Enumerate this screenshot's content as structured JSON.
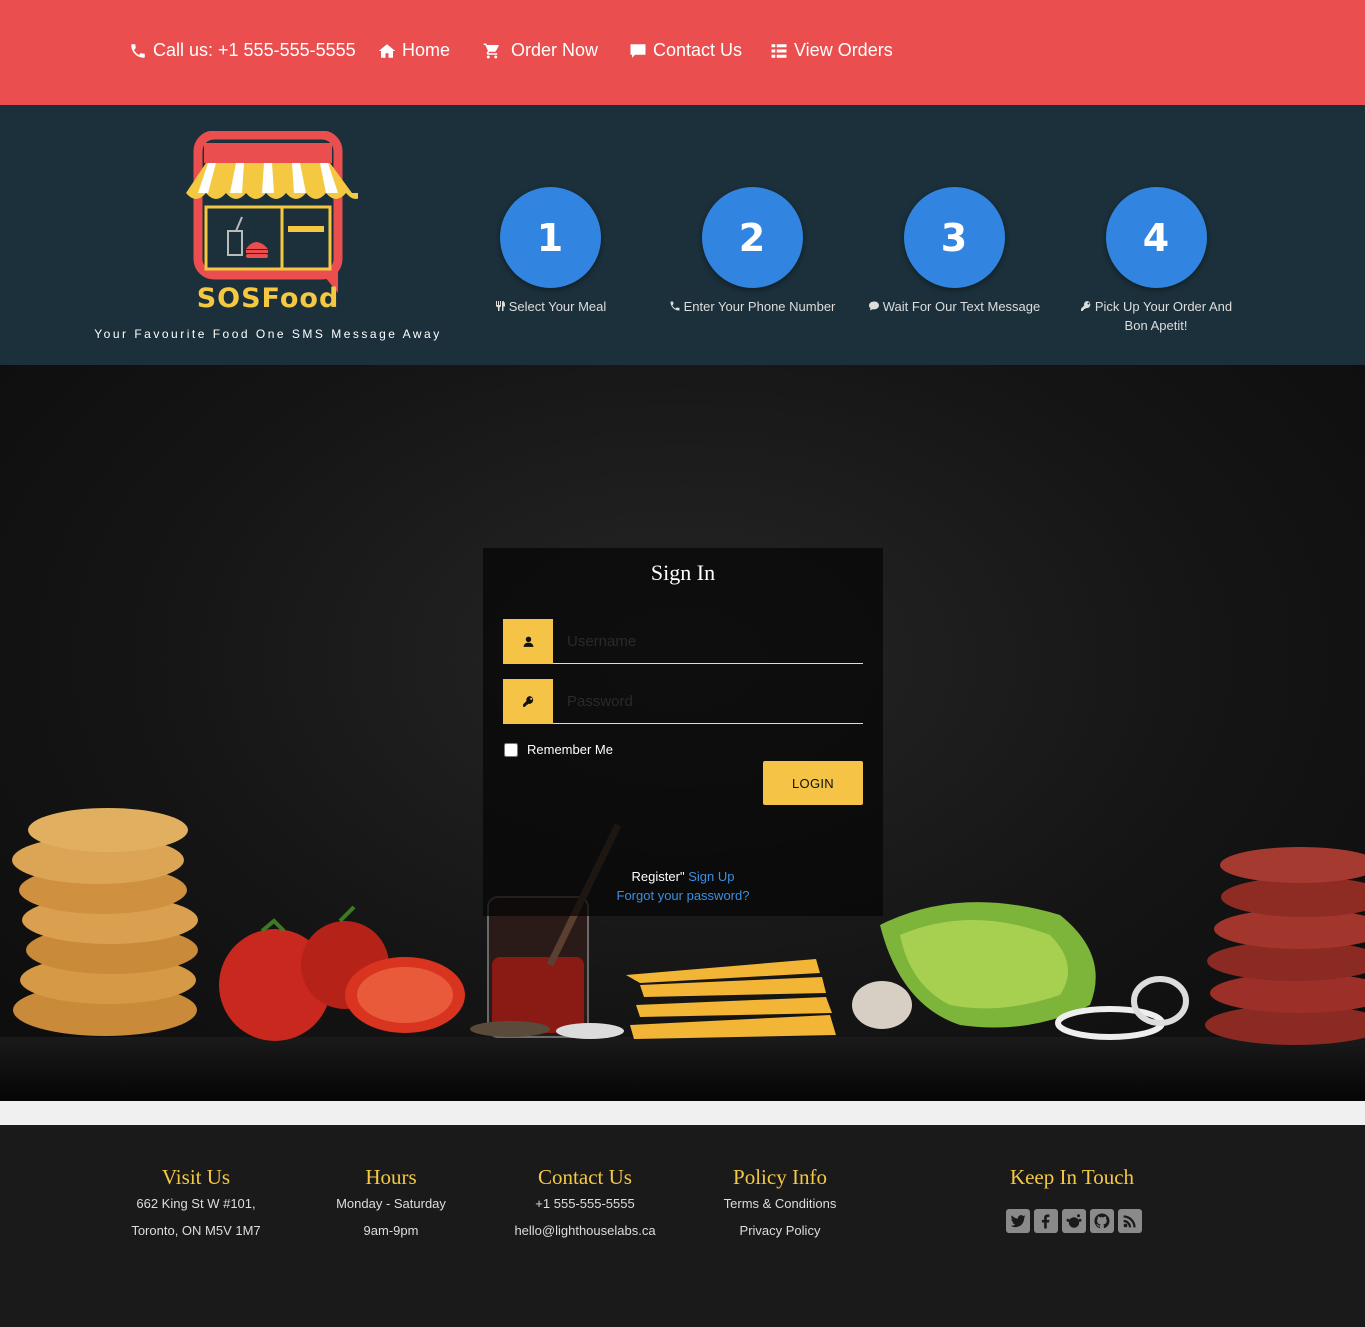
{
  "nav": {
    "call": "Call us: +1 555-555-5555",
    "home": "Home",
    "order": "Order Now",
    "contact": "Contact Us",
    "view_orders": "View Orders"
  },
  "brand": {
    "name": "SOSFood",
    "tagline": "Your Favourite Food One SMS Message Away"
  },
  "steps": [
    {
      "number": "1",
      "label": "Select Your Meal",
      "icon": "cutlery-icon"
    },
    {
      "number": "2",
      "label": "Enter Your Phone Number",
      "icon": "phone-icon"
    },
    {
      "number": "3",
      "label": "Wait For Our Text Message",
      "icon": "comment-icon"
    },
    {
      "number": "4",
      "label": "Pick Up Your Order And Bon Apetit!",
      "icon": "key-icon"
    }
  ],
  "signin": {
    "title": "Sign In",
    "username_placeholder": "Username",
    "password_placeholder": "Password",
    "remember": "Remember Me",
    "login": "LOGIN",
    "register_text": "Register\"",
    "signup_link": "Sign Up",
    "forgot": "Forgot your password?"
  },
  "footer": {
    "visit": {
      "title": "Visit Us",
      "line1": "662 King St W #101,",
      "line2": "Toronto, ON M5V 1M7"
    },
    "hours": {
      "title": "Hours",
      "line1": "Monday - Saturday",
      "line2": "9am-9pm"
    },
    "contact": {
      "title": "Contact Us",
      "line1": "+1 555-555-5555",
      "line2": "hello@lighthouselabs.ca"
    },
    "policy": {
      "title": "Policy Info",
      "line1": "Terms & Conditions",
      "line2": "Privacy Policy"
    },
    "social": {
      "title": "Keep In Touch",
      "icons": [
        "twitter-icon",
        "facebook-icon",
        "reddit-icon",
        "github-icon",
        "rss-icon"
      ]
    }
  },
  "colors": {
    "nav_bg": "#ea4e4e",
    "banner_bg": "#1b303b",
    "step_circle": "#3184e0",
    "accent_yellow": "#f5c345",
    "link_blue": "#3b8fe2",
    "footer_bg": "#1a1a1a"
  }
}
